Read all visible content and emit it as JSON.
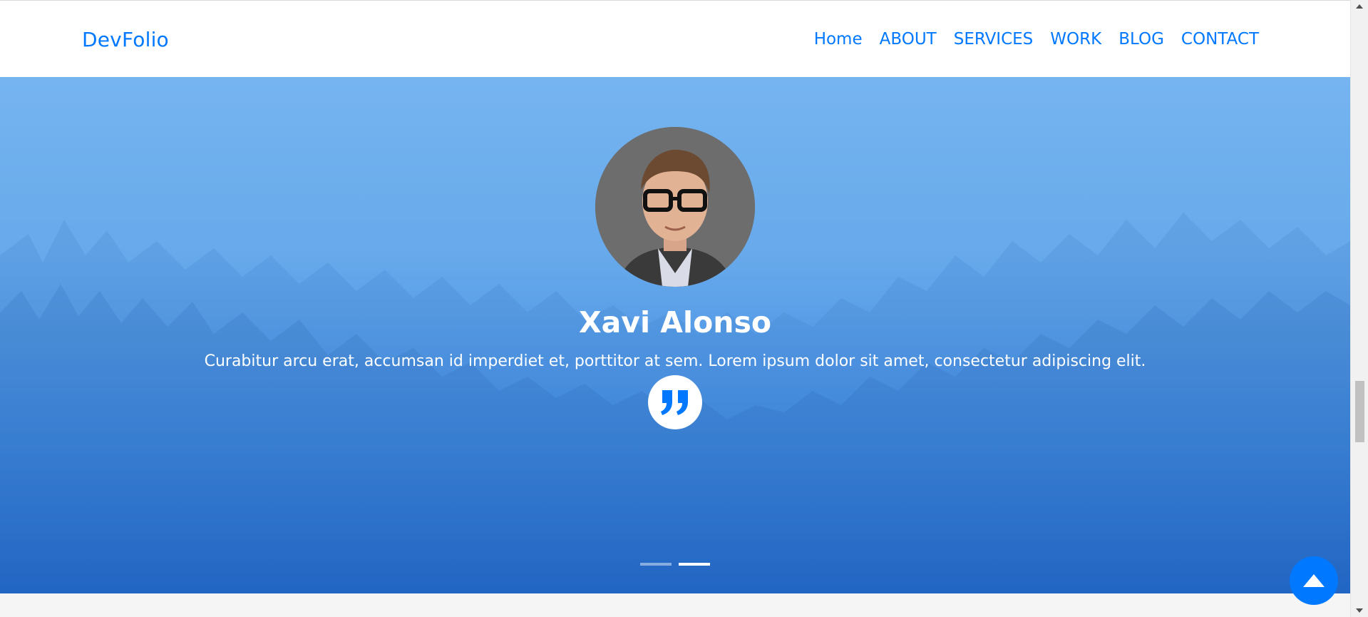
{
  "navbar": {
    "brand": "DevFolio",
    "links": [
      "Home",
      "ABOUT",
      "SERVICES",
      "WORK",
      "BLOG",
      "CONTACT"
    ]
  },
  "testimonial": {
    "name": "Xavi Alonso",
    "text": "Curabitur arcu erat, accumsan id imperdiet et, porttitor at sem. Lorem ipsum dolor sit amet, consectetur adipiscing elit.",
    "quote_icon": "quote-icon",
    "active_slide": 2,
    "slide_count": 2
  },
  "colors": {
    "accent": "#0078ff",
    "hero_top": "#66acee",
    "hero_bottom": "#2266cc"
  },
  "icons": {
    "back_to_top": "chevron-up-icon",
    "scroll_up": "scroll-up-arrow-icon",
    "scroll_down": "scroll-down-arrow-icon"
  }
}
